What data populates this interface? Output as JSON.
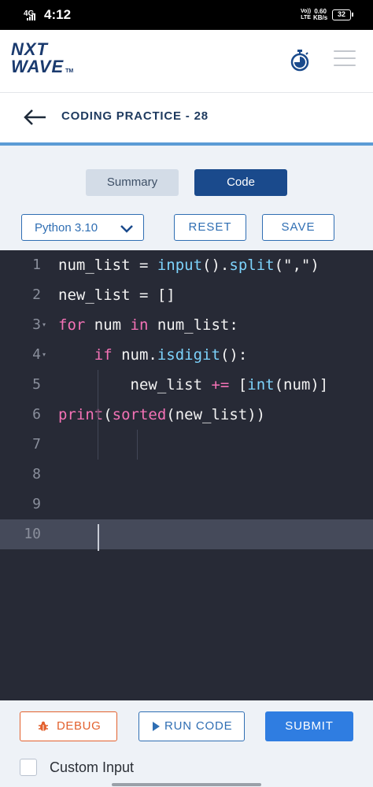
{
  "status_bar": {
    "network": "4G",
    "time": "4:12",
    "volte_line1": "Vo))",
    "volte_line2": "LTE",
    "speed_value": "0.60",
    "speed_unit": "KB/s",
    "battery": "32"
  },
  "header": {
    "logo_line1": "NXT",
    "logo_line2": "WAVE",
    "logo_tm": "TM",
    "timer_icon": "stopwatch-icon",
    "menu_icon": "hamburger-menu-icon"
  },
  "title_bar": {
    "back_icon": "arrow-left-icon",
    "title": "CODING PRACTICE - 28"
  },
  "tabs": {
    "summary": "Summary",
    "code": "Code",
    "active": "Code"
  },
  "toolbar": {
    "language": "Python 3.10",
    "reset_label": "RESET",
    "save_label": "SAVE"
  },
  "editor": {
    "line_numbers": [
      "1",
      "2",
      "3",
      "4",
      "5",
      "6",
      "7",
      "8",
      "9",
      "10"
    ],
    "active_line": "10",
    "lines": [
      [
        {
          "t": "num_list = ",
          "c": "plain"
        },
        {
          "t": "input",
          "c": "fn"
        },
        {
          "t": "().",
          "c": "plain"
        },
        {
          "t": "split",
          "c": "fn"
        },
        {
          "t": "(\",\")",
          "c": "plain"
        }
      ],
      [
        {
          "t": "new_list = []",
          "c": "plain"
        }
      ],
      [
        {
          "t": "for",
          "c": "kw"
        },
        {
          "t": " num ",
          "c": "plain"
        },
        {
          "t": "in",
          "c": "kw"
        },
        {
          "t": " num_list:",
          "c": "plain"
        }
      ],
      [
        {
          "t": "    ",
          "c": "plain"
        },
        {
          "t": "if",
          "c": "kw"
        },
        {
          "t": " num.",
          "c": "plain"
        },
        {
          "t": "isdigit",
          "c": "fn"
        },
        {
          "t": "():",
          "c": "plain"
        }
      ],
      [
        {
          "t": "        new_list ",
          "c": "plain"
        },
        {
          "t": "+=",
          "c": "kw"
        },
        {
          "t": " [",
          "c": "plain"
        },
        {
          "t": "int",
          "c": "fn"
        },
        {
          "t": "(num)]",
          "c": "plain"
        }
      ],
      [
        {
          "t": "print",
          "c": "kw"
        },
        {
          "t": "(",
          "c": "plain"
        },
        {
          "t": "sorted",
          "c": "kw"
        },
        {
          "t": "(new_list))",
          "c": "plain"
        }
      ],
      [],
      [],
      [],
      []
    ]
  },
  "bottom": {
    "debug_label": "DEBUG",
    "run_label": "RUN CODE",
    "submit_label": "SUBMIT",
    "custom_input_label": "Custom Input",
    "custom_input_checked": false
  },
  "colors": {
    "brand_navy": "#1a4a8c",
    "accent_blue": "#2f7de1",
    "debug_orange": "#e3612e",
    "editor_bg": "#272a36",
    "keyword_pink": "#f472b6",
    "function_blue": "#7dd3fc"
  }
}
